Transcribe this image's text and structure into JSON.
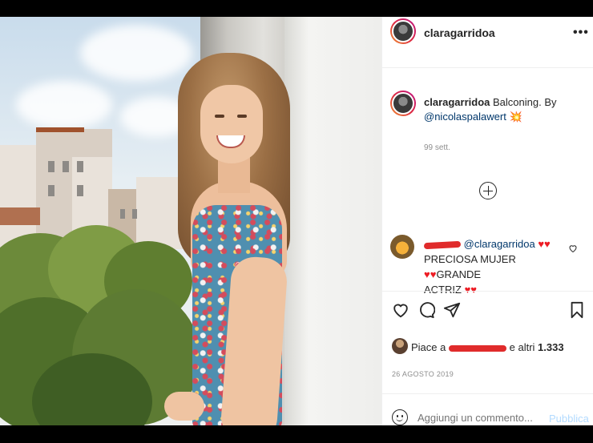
{
  "post": {
    "username": "claragarridoa",
    "more_label": "•••",
    "caption_user": "claragarridoa",
    "caption_text": "Balconing. By",
    "caption_mention": "@nicolaspalawert",
    "caption_emoji": "💥",
    "caption_time": "99 sett.",
    "load_more_icon": "plus-circle-icon"
  },
  "comment": {
    "mention": "@claragarridoa",
    "text_line1": "PRECIOSA MUJER",
    "text_line2": "GRANDE",
    "text_line3": "ACTRIZ",
    "hearts": "♥♥",
    "heart_color": "#ed1c24"
  },
  "actions": {
    "like_icon": "heart-outline-icon",
    "comment_icon": "speech-bubble-icon",
    "share_icon": "paper-plane-icon",
    "save_icon": "bookmark-icon"
  },
  "likes": {
    "prefix": "Piace a",
    "suffix": "e altri",
    "count": "1.333"
  },
  "date": "26 AGOSTO 2019",
  "compose": {
    "placeholder": "Aggiungi un commento...",
    "publish_label": "Pubblica"
  },
  "colors": {
    "link": "#00376b",
    "publish": "#b3dbff",
    "redaction": "#e02b2b"
  }
}
